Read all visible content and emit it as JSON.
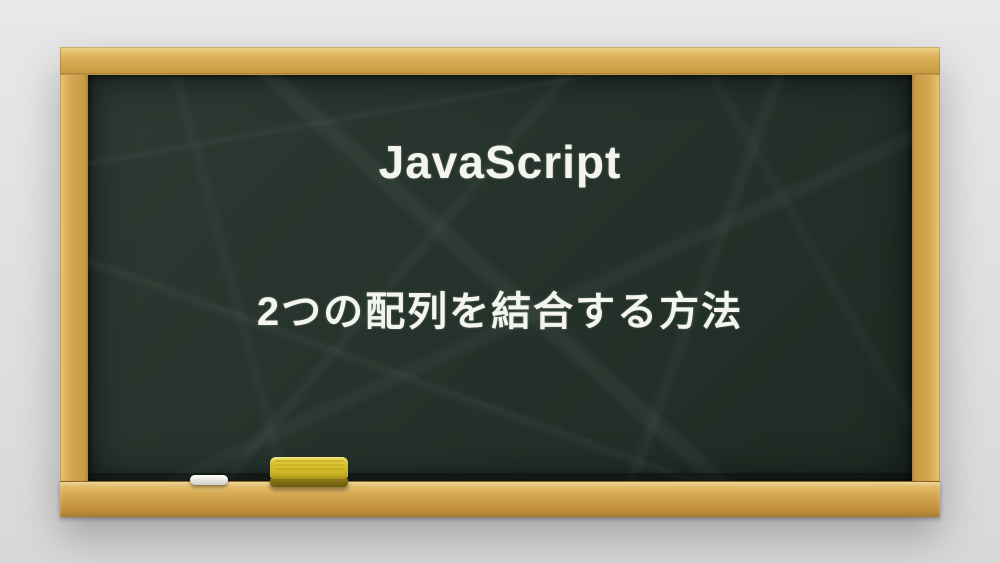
{
  "board": {
    "title": "JavaScript",
    "subtitle": "2つの配列を結合する方法"
  },
  "accessories": {
    "chalk": "chalk",
    "eraser": "sponge-eraser"
  },
  "colors": {
    "frame": "#d4a650",
    "board": "#25322b",
    "chalk_text": "#f5f5f0",
    "eraser": "#d4bc2a"
  }
}
